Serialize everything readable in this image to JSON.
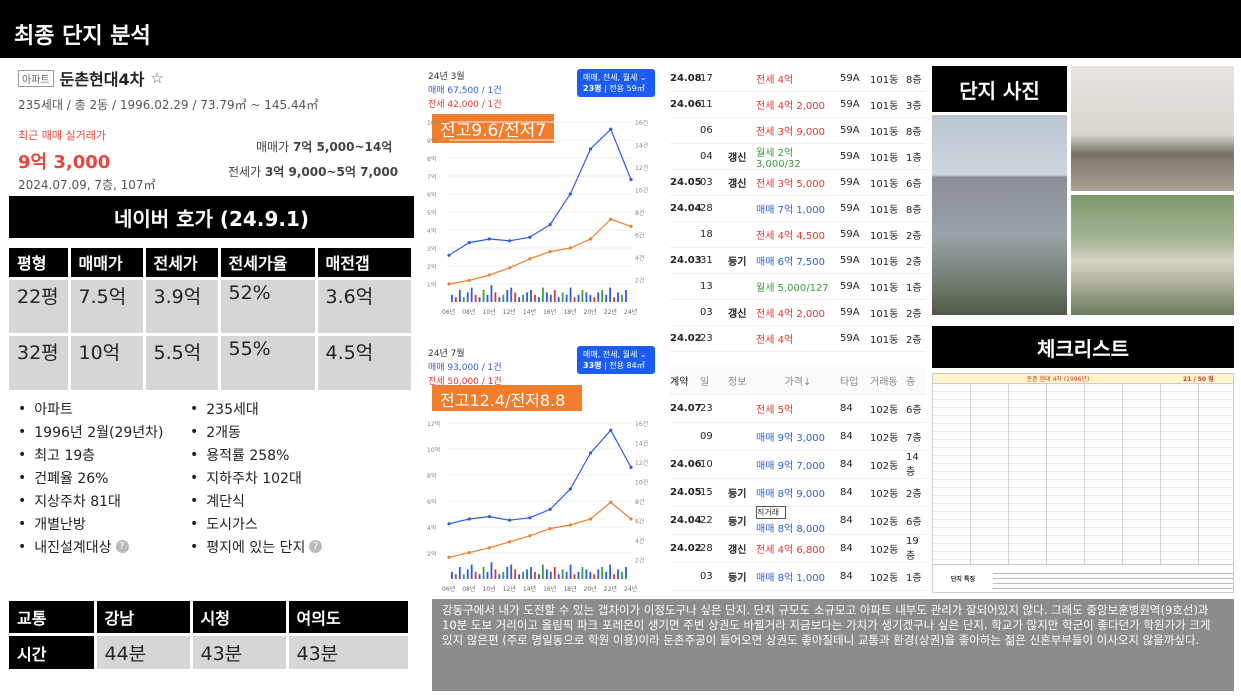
{
  "page": {
    "title": "최종 단지 분석"
  },
  "complex": {
    "tag": "아파트",
    "name": "둔촌현대4차",
    "info": "235세대 / 총 2동 / 1996.02.29 / 73.79㎡ ~ 145.44㎡",
    "recent_label": "최근 매매 실거래가",
    "recent_price": "9억 3,000",
    "recent_detail": "2024.07.09, 7층, 107㎡",
    "sale_range_label": "매매가",
    "sale_range": "7억 5,000~14억",
    "jeonse_range_label": "전세가",
    "jeonse_range": "3억 9,000~5억 7,000"
  },
  "naver": {
    "title": "네이버 호가 (24.9.1)",
    "headers": [
      "평형",
      "매매가",
      "전세가",
      "전세가율",
      "매전갭"
    ],
    "rows": [
      [
        "22평",
        "7.5억",
        "3.9억",
        "52%",
        "3.6억"
      ],
      [
        "32평",
        "10억",
        "5.5억",
        "55%",
        "4.5억"
      ]
    ]
  },
  "features": {
    "left": [
      "아파트",
      "1996년 2월(29년차)",
      "최고 19층",
      "건폐율 26%",
      "지상주차 81대",
      "개별난방",
      "내진설계대상"
    ],
    "right": [
      "235세대",
      "2개동",
      "용적률 258%",
      "지하주차 102대",
      "계단식",
      "도시가스",
      "평지에 있는 단지"
    ]
  },
  "commute": {
    "headers": [
      "교통",
      "강남",
      "시청",
      "여의도"
    ],
    "row_label": "시간",
    "values": [
      "44분",
      "43분",
      "43분"
    ]
  },
  "chart1": {
    "period": "24년 3월",
    "sale": "매매 67,500 / 1건",
    "jeonse": "전세 42,000 / 1건",
    "dropdown": "매매, 전세, 월세",
    "area": "23평",
    "area_detail": "전용 59㎡",
    "overlay": "전고9.6/전저7",
    "y_left": [
      "10억",
      "9억",
      "8억",
      "7억",
      "6억",
      "5억",
      "4억",
      "3억",
      "2억",
      "1억"
    ],
    "y_right": [
      "16건",
      "14건",
      "12건",
      "10건",
      "8건",
      "6건",
      "4건",
      "2건"
    ],
    "x_ticks": [
      "06년",
      "08년",
      "10년",
      "12년",
      "14년",
      "16년",
      "18년",
      "20년",
      "22년",
      "24년"
    ]
  },
  "chart2": {
    "period": "24년 7월",
    "sale": "매매 93,000 / 1건",
    "jeonse": "전세 50,000 / 1건",
    "dropdown": "매매, 전세, 월세",
    "area": "33평",
    "area_detail": "전용 84㎡",
    "overlay": "전고12.4/전저8.8",
    "y_left": [
      "12억",
      "10억",
      "8억",
      "6억",
      "4억",
      "2억"
    ],
    "y_right": [
      "16건",
      "14건",
      "12건",
      "10건",
      "8건",
      "6건",
      "4건",
      "2건"
    ],
    "x_ticks": [
      "06년",
      "08년",
      "10년",
      "12년",
      "14년",
      "16년",
      "18년",
      "20년",
      "22년",
      "24년"
    ]
  },
  "chart_data": [
    {
      "type": "line",
      "title": "",
      "x": [
        "06년",
        "08년",
        "10년",
        "12년",
        "14년",
        "16년",
        "18년",
        "20년",
        "22년",
        "24년"
      ],
      "series": [
        {
          "name": "매매",
          "values": [
            2.6,
            3.3,
            3.5,
            3.4,
            3.6,
            4.3,
            6.0,
            8.5,
            9.6,
            6.8
          ],
          "color": "#2d5be3"
        },
        {
          "name": "전세",
          "values": [
            1.0,
            1.2,
            1.5,
            1.9,
            2.4,
            2.8,
            3.0,
            3.5,
            4.6,
            4.2
          ],
          "color": "#f27d2c"
        }
      ],
      "ylim": [
        0,
        10
      ]
    },
    {
      "type": "line",
      "title": "",
      "x": [
        "06년",
        "08년",
        "10년",
        "12년",
        "14년",
        "16년",
        "18년",
        "20년",
        "22년",
        "24년"
      ],
      "series": [
        {
          "name": "매매",
          "values": [
            4.6,
            5.0,
            5.2,
            4.9,
            5.1,
            5.8,
            7.5,
            10.5,
            12.4,
            9.3
          ],
          "color": "#2d5be3"
        },
        {
          "name": "전세",
          "values": [
            1.8,
            2.2,
            2.6,
            3.1,
            3.6,
            4.2,
            4.5,
            5.0,
            6.4,
            5.0
          ],
          "color": "#f27d2c"
        }
      ],
      "ylim": [
        0,
        13
      ]
    }
  ],
  "transactions_a": [
    {
      "ym": "24.08",
      "d": "17",
      "info": "",
      "type": "jeon",
      "price": "전세 4억",
      "t": "59A",
      "b": "101동",
      "f": "8층"
    },
    {
      "ym": "24.06",
      "d": "11",
      "info": "",
      "type": "jeon",
      "price": "전세 4억 2,000",
      "t": "59A",
      "b": "101동",
      "f": "3층"
    },
    {
      "ym": "",
      "d": "06",
      "info": "",
      "type": "jeon",
      "price": "전세 3억 9,000",
      "t": "59A",
      "b": "101동",
      "f": "8층"
    },
    {
      "ym": "",
      "d": "04",
      "info": "갱신",
      "type": "wol",
      "price": "월세 2억 3,000/32",
      "t": "59A",
      "b": "101동",
      "f": "1층"
    },
    {
      "ym": "24.05",
      "d": "03",
      "info": "갱신",
      "type": "jeon",
      "price": "전세 3억 5,000",
      "t": "59A",
      "b": "101동",
      "f": "6층"
    },
    {
      "ym": "24.04",
      "d": "28",
      "info": "",
      "type": "sale",
      "price": "매매 7억 1,000",
      "t": "59A",
      "b": "101동",
      "f": "8층"
    },
    {
      "ym": "",
      "d": "18",
      "info": "",
      "type": "jeon",
      "price": "전세 4억 4,500",
      "t": "59A",
      "b": "101동",
      "f": "2층"
    },
    {
      "ym": "24.03",
      "d": "31",
      "info": "등기",
      "type": "sale",
      "price": "매매 6억 7,500",
      "t": "59A",
      "b": "101동",
      "f": "2층"
    },
    {
      "ym": "",
      "d": "13",
      "info": "",
      "type": "wol",
      "price": "월세 5,000/127",
      "t": "59A",
      "b": "101동",
      "f": "1층"
    },
    {
      "ym": "",
      "d": "03",
      "info": "갱신",
      "type": "jeon",
      "price": "전세 4억 2,000",
      "t": "59A",
      "b": "101동",
      "f": "2층"
    },
    {
      "ym": "24.02",
      "d": "23",
      "info": "",
      "type": "jeon",
      "price": "전세 4억",
      "t": "59A",
      "b": "101동",
      "f": "2층"
    }
  ],
  "transactions_b_headers": [
    "계약",
    "일",
    "정보",
    "가격↓",
    "타입",
    "거래동",
    "층"
  ],
  "transactions_b": [
    {
      "ym": "24.07",
      "d": "23",
      "info": "",
      "type": "jeon",
      "price": "전세 5억",
      "t": "84",
      "b": "102동",
      "f": "6층"
    },
    {
      "ym": "",
      "d": "09",
      "info": "",
      "type": "sale",
      "price": "매매 9억 3,000",
      "t": "84",
      "b": "102동",
      "f": "7층"
    },
    {
      "ym": "24.06",
      "d": "10",
      "info": "",
      "type": "sale",
      "price": "매매 9억 7,000",
      "t": "84",
      "b": "102동",
      "f": "14층"
    },
    {
      "ym": "24.05",
      "d": "15",
      "info": "등기",
      "type": "sale",
      "price": "매매 8억 9,000",
      "t": "84",
      "b": "102동",
      "f": "2층"
    },
    {
      "ym": "24.04",
      "d": "22",
      "info": "등기",
      "type": "sale",
      "price": "매매 8억 8,000",
      "tag": "직거래",
      "t": "84",
      "b": "102동",
      "f": "6층"
    },
    {
      "ym": "24.02",
      "d": "28",
      "info": "갱신",
      "type": "jeon",
      "price": "전세 4억 6,800",
      "t": "84",
      "b": "102동",
      "f": "19층"
    },
    {
      "ym": "",
      "d": "03",
      "info": "등기",
      "type": "sale",
      "price": "매매 8억 1,000",
      "t": "84",
      "b": "102동",
      "f": "1층"
    }
  ],
  "photo_title": "단지 사진",
  "checklist": {
    "title": "체크리스트",
    "sheet_title": "둔촌 현대 4차 (1996년)",
    "score": "21 / 50 점",
    "footer_label": "단지 특징"
  },
  "note": "강동구에서 내가 도전할 수 있는 갭차이가 이정도구나 싶은 단지. 단지 규모도 소규모고 아파트 내부도 관리가 잘되어있지 않다. 그래도 중앙보훈병원역(9호선)과 10분 도보 거리이고 올림픽 파크 포레온이 생기면 주변 상권도 바뀔거라 지금보다는 가치가 생기겠구나 싶은 단지. 학교가 많지만 학군이 좋다던가 학원가가 크게 있지 않은편 (주로 명일동으로 학원 이용)이라 둔촌주공이 들어오면 상권도 좋아질테니 교통과 환경(상권)을 좋아하는 젊은 신혼부부들이 이사오지 않을까싶다."
}
